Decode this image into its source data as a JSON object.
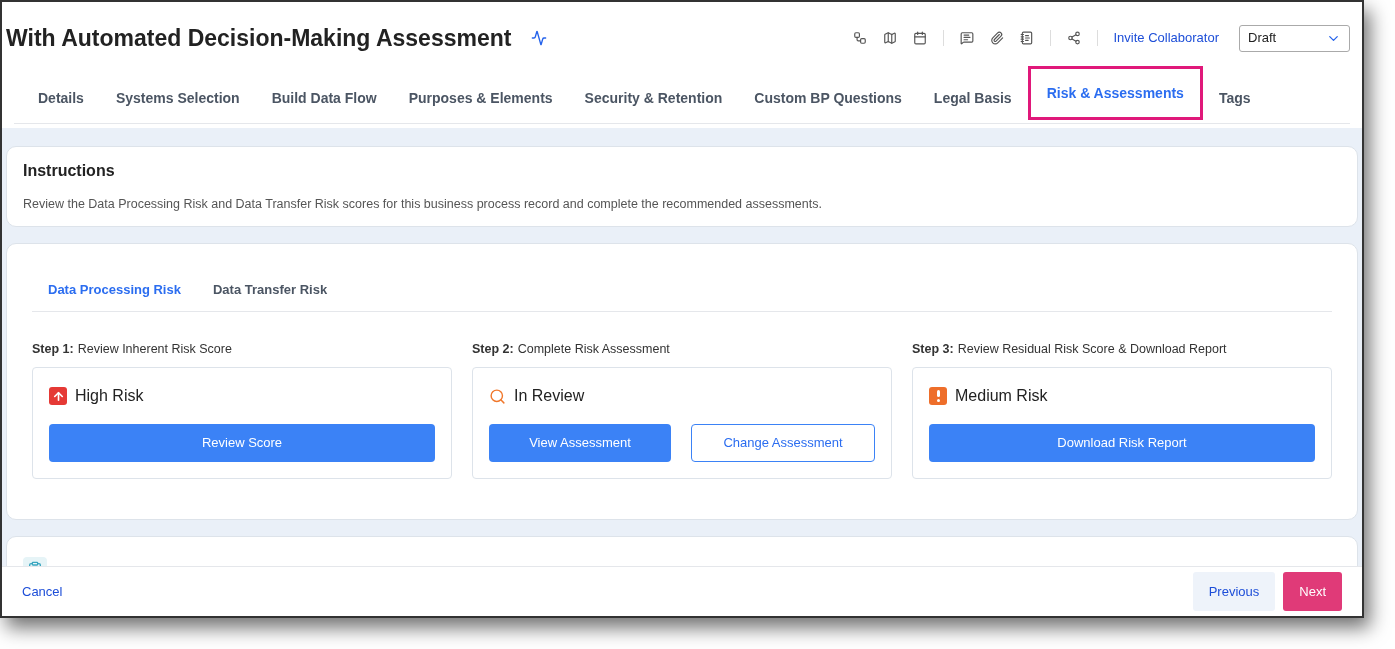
{
  "header": {
    "title": "With Automated Decision-Making Assessment",
    "invite_link": "Invite Collaborator",
    "status_select": {
      "value": "Draft"
    }
  },
  "tabs": [
    {
      "label": "Details",
      "selected": false
    },
    {
      "label": "Systems Selection",
      "selected": false
    },
    {
      "label": "Build Data Flow",
      "selected": false
    },
    {
      "label": "Purposes & Elements",
      "selected": false
    },
    {
      "label": "Security & Retention",
      "selected": false
    },
    {
      "label": "Custom BP Questions",
      "selected": false
    },
    {
      "label": "Legal Basis",
      "selected": false
    },
    {
      "label": "Risk & Assessments",
      "selected": true
    },
    {
      "label": "Tags",
      "selected": false
    }
  ],
  "instructions": {
    "title": "Instructions",
    "text": "Review the Data Processing Risk and Data Transfer Risk scores for this business process record and complete the recommended assessments."
  },
  "risk_tabs": [
    {
      "label": "Data Processing Risk",
      "selected": true
    },
    {
      "label": "Data Transfer Risk",
      "selected": false
    }
  ],
  "steps": [
    {
      "step": "Step 1:",
      "description": "Review Inherent Risk Score",
      "status": {
        "kind": "high",
        "label": "High Risk"
      },
      "buttons": [
        {
          "label": "Review Score",
          "kind": "primary"
        }
      ]
    },
    {
      "step": "Step 2:",
      "description": "Complete Risk Assessment",
      "status": {
        "kind": "review",
        "label": "In Review"
      },
      "buttons": [
        {
          "label": "View Assessment",
          "kind": "primary"
        },
        {
          "label": "Change Assessment",
          "kind": "outline"
        }
      ]
    },
    {
      "step": "Step 3:",
      "description": "Review Residual Risk Score & Download Report",
      "status": {
        "kind": "medium",
        "label": "Medium Risk"
      },
      "buttons": [
        {
          "label": "Download Risk Report",
          "kind": "primary"
        }
      ]
    }
  ],
  "footer": {
    "cancel": "Cancel",
    "previous": "Previous",
    "next": "Next"
  }
}
